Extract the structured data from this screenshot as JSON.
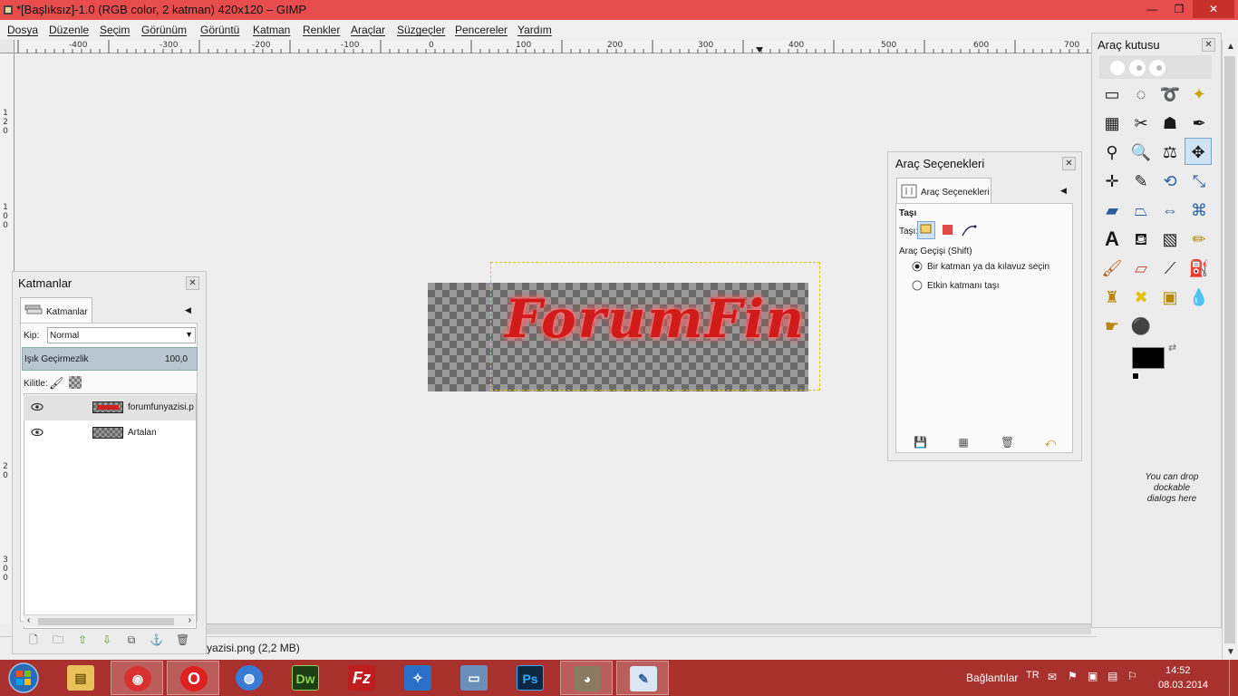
{
  "window": {
    "title": "*[Başlıksız]-1.0 (RGB color, 2 katman) 420x120 – GIMP",
    "min_glyph": "—",
    "max_glyph": "❐",
    "close_glyph": "✕"
  },
  "menu": [
    "Dosya",
    "Düzenle",
    "Seçim",
    "Görünüm",
    "Görüntü",
    "Katman",
    "Renkler",
    "Araçlar",
    "Süzgeçler",
    "Pencereler",
    "Yardım"
  ],
  "hruler": [
    "-400",
    "-300",
    "-200",
    "-100",
    "0",
    "100",
    "200",
    "300",
    "400",
    "500",
    "600",
    "700"
  ],
  "vruler": [
    "1",
    "2",
    "0",
    "1",
    "0",
    "0",
    "2",
    "0",
    "3",
    "0",
    "0",
    "0"
  ],
  "canvas": {
    "logo_text": "ForumFin"
  },
  "statusbar": {
    "text": "yazisi.png (2,2 MB)"
  },
  "layers_panel": {
    "title": "Katmanlar",
    "tab_label": "Katmanlar",
    "mode_label": "Kip:",
    "mode_value": "Normal",
    "opacity_label": "Işık Geçirmezlik",
    "opacity_value": "100,0",
    "lock_label": "Kilitle:",
    "layers": [
      {
        "name": "forumfunyazisi.p",
        "selected": true
      },
      {
        "name": "Artalan",
        "selected": false
      }
    ]
  },
  "tool_options": {
    "title": "Araç Seçenekleri",
    "tab_label": "Araç Seçenekleri",
    "tool_name": "Taşı",
    "move_label": "Taşı:",
    "toggle_label": "Araç Geçişi  (Shift)",
    "options": [
      {
        "label": "Bir katman ya da kılavuz seçin",
        "checked": true
      },
      {
        "label": "Etkin katmanı taşı",
        "checked": false
      }
    ]
  },
  "toolbox": {
    "title": "Araç kutusu",
    "drop_hint": "You can drop dockable dialogs here",
    "tools": [
      "rect-select",
      "ellipse-select",
      "free-select",
      "fuzzy-select",
      "color-select",
      "scissors-select",
      "foreground-select",
      "paths",
      "color-picker",
      "zoom",
      "measure",
      "move",
      "align",
      "crop",
      "rotate",
      "scale",
      "shear",
      "perspective",
      "flip",
      "cage-transform",
      "text",
      "bucket-fill",
      "blend",
      "pencil",
      "paintbrush",
      "eraser",
      "airbrush",
      "ink",
      "clone",
      "heal",
      "perspective-clone",
      "blur",
      "smudge",
      "dodge-burn"
    ],
    "active_tool": "move",
    "fg_color": "#000000",
    "bg_color": "#ffffff"
  },
  "taskbar": {
    "apps": [
      "Windows Explorer",
      "Tarayıcı",
      "Opera",
      "Internet",
      "Dreamweaver",
      "FileZilla",
      "Uygulama",
      "Bilgisayar",
      "Photoshop",
      "GIMP",
      "Çizim"
    ],
    "active_app": "GIMP",
    "tray_label": "Bağlantılar",
    "lang": "TR",
    "time": "14:52",
    "date": "08.03.2014"
  }
}
